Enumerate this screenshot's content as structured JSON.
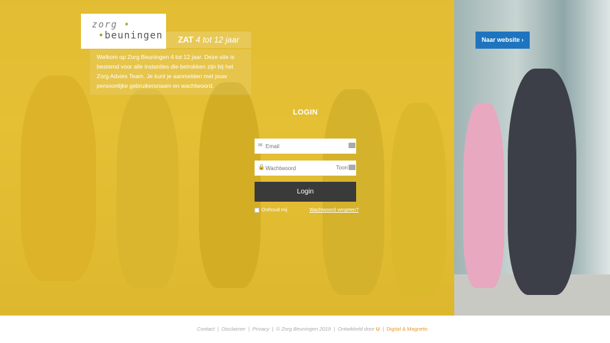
{
  "logo": {
    "line1": "zorg",
    "line2": "beuningen",
    "dot": "•"
  },
  "tagline": {
    "bold": "ZAT",
    "rest": "4 tot 12 jaar"
  },
  "welcome_text": "Welkom op Zorg Beuningen 4 tot 12 jaar. Deze site is bestemd voor alle instanties die betrokken zijn bij het Zorg Advies Team. Je kunt je aanmelden met jouw persoonlijke gebruikersnaam en wachtwoord.",
  "naar_website": {
    "label": "Naar website",
    "icon": "chevron-right-icon"
  },
  "login": {
    "title": "LOGIN",
    "email_placeholder": "Email",
    "password_placeholder": "Wachtwoord",
    "show_label": "Toon",
    "button_label": "Login",
    "remember_label": "Onthoud mij",
    "forgot_label": "Wachtwoord vergeten?"
  },
  "footer": {
    "contact": "Contact",
    "disclaimer": "Disclaimer",
    "privacy": "Privacy",
    "copyright": "© Zorg Beuningen 2019",
    "developed_by": "Ontwikkeld door",
    "dev_logo": "U",
    "dev_name": "Digital & Magnetic",
    "separator": "|"
  },
  "colors": {
    "overlay": "#e8be22",
    "button": "#3a3a3a",
    "naar_button": "#1f74bf",
    "accent": "#e59a2c"
  }
}
